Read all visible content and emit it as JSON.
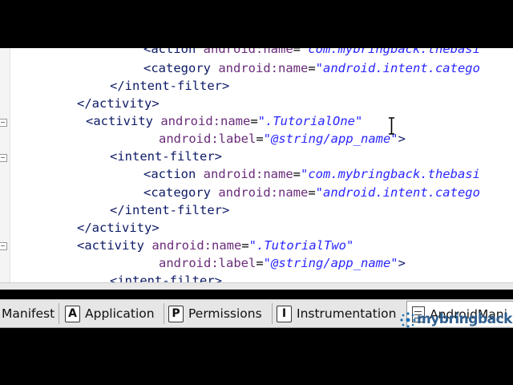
{
  "editor": {
    "lines": [
      {
        "tag": "<action",
        "attr": "android:name",
        "eq": "=",
        "val": "\"com.mybringback.thebasi"
      },
      {
        "tag": "<category",
        "attr": "android:name",
        "eq": "=",
        "val": "\"android.intent.catego"
      },
      {
        "tag": "</intent-filter>",
        "attr": "",
        "eq": "",
        "val": ""
      },
      {
        "tag": "</activity>",
        "attr": "",
        "eq": "",
        "val": ""
      },
      {
        "tag": "<activity",
        "attr": "android:name",
        "eq": "=",
        "val": "\".TutorialOne\""
      },
      {
        "tag": "",
        "attr": "android:label",
        "eq": "=",
        "val": "\"@string/app_name\"",
        "close": ">"
      },
      {
        "tag": "<intent-filter>",
        "attr": "",
        "eq": "",
        "val": ""
      },
      {
        "tag": "<action",
        "attr": "android:name",
        "eq": "=",
        "val": "\"com.mybringback.thebasi"
      },
      {
        "tag": "<category",
        "attr": "android:name",
        "eq": "=",
        "val": "\"android.intent.catego"
      },
      {
        "tag": "</intent-filter>",
        "attr": "",
        "eq": "",
        "val": ""
      },
      {
        "tag": "</activity>",
        "attr": "",
        "eq": "",
        "val": ""
      },
      {
        "tag": "<activity",
        "attr": "android:name",
        "eq": "=",
        "val": "\".TutorialTwo\""
      },
      {
        "tag": "",
        "attr": "android:label",
        "eq": "=",
        "val": "\"@string/app_name\"",
        "close": ">"
      },
      {
        "tag": "<intent-filter>",
        "attr": "",
        "eq": "",
        "val": ""
      }
    ]
  },
  "tabs": [
    {
      "letter": "",
      "label": "Manifest"
    },
    {
      "letter": "A",
      "label": "Application"
    },
    {
      "letter": "P",
      "label": "Permissions"
    },
    {
      "letter": "I",
      "label": "Instrumentation"
    },
    {
      "letter": "",
      "label": "AndroidMani",
      "icon": "xml-file-icon",
      "active": true
    }
  ],
  "watermark": {
    "text": "mybringback",
    "icon": "mybringback-logo-icon"
  },
  "colors": {
    "tag": "#0d1a66",
    "attribute": "#6a2c7a",
    "value": "#2a26ff",
    "background": "#ffffff",
    "letterbox": "#000000"
  }
}
